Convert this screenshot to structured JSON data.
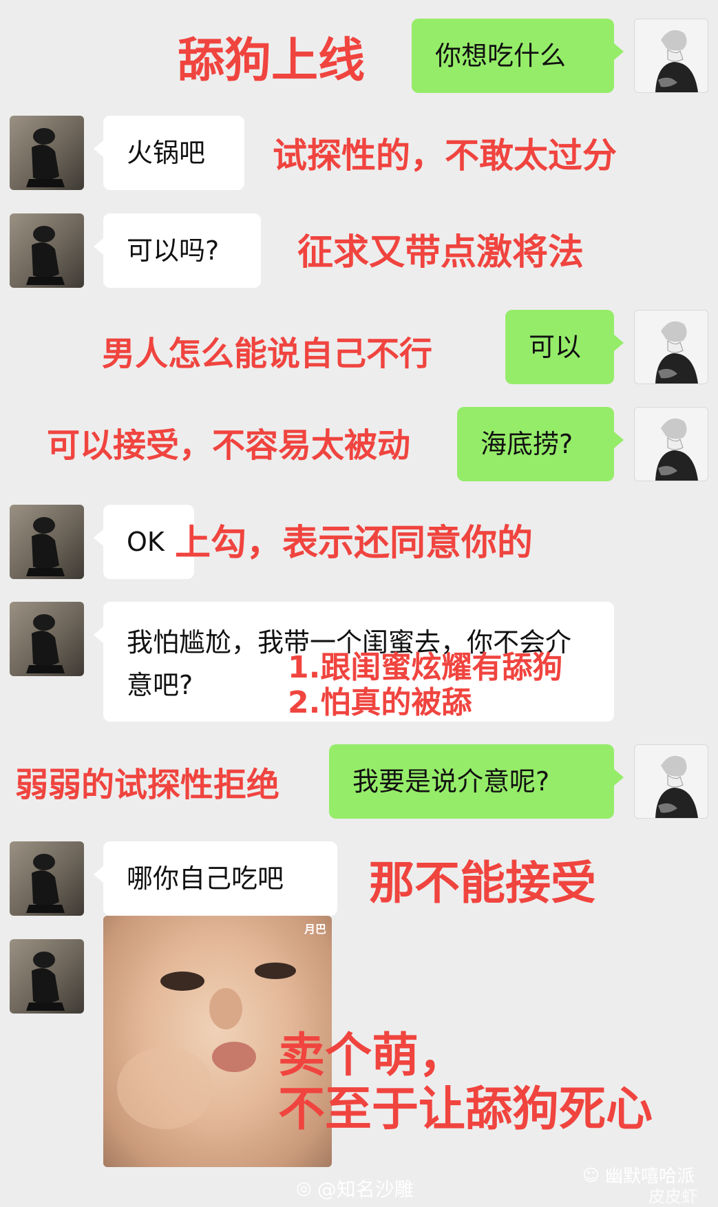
{
  "messages": [
    {
      "text": "你想吃什么"
    },
    {
      "text": "火锅吧"
    },
    {
      "text": "可以吗?"
    },
    {
      "text": "可以"
    },
    {
      "text": "海底捞?"
    },
    {
      "text": "OK"
    },
    {
      "text": "我怕尴尬，我带一个闺蜜去，你不会介意吧?"
    },
    {
      "text": "我要是说介意呢?"
    },
    {
      "text": "哪你自己吃吧"
    }
  ],
  "annotations": [
    "舔狗上线",
    "试探性的，不敢太过分",
    "征求又带点激将法",
    "男人怎么能说自己不行",
    "可以接受，不容易太被动",
    "上勾，表示还同意你的",
    "1.跟闺蜜炫耀有舔狗\n2.怕真的被舔",
    "弱弱的试探性拒绝",
    "那不能接受",
    "卖个萌，\n不至于让舔狗死心"
  ],
  "sticker": {
    "corner_text": "月巴"
  },
  "watermarks": {
    "weibo": "@知名沙雕",
    "wechat": "幽默嘻哈派",
    "brand": "皮皮虾"
  },
  "colors": {
    "background": "#ededed",
    "green_bubble": "#95ec69",
    "white_bubble": "#ffffff",
    "annotation": "#f0443f"
  }
}
